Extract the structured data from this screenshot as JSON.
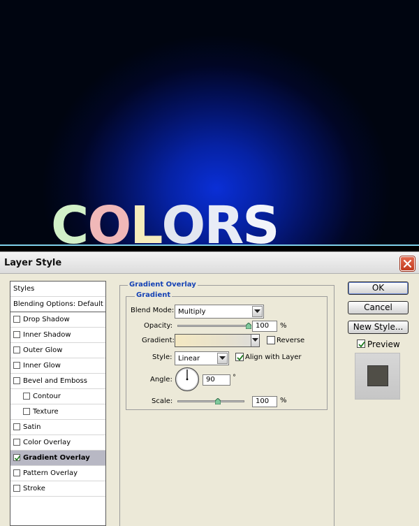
{
  "canvas": {
    "letters": [
      {
        "char": "C",
        "color": "#d2f0c8"
      },
      {
        "char": "O",
        "color": "#f0b8b8"
      },
      {
        "char": "L",
        "color": "#f6ecbc"
      },
      {
        "char": "O",
        "color": "#e2e6f0"
      },
      {
        "char": "R",
        "color": "#e8ecf6"
      },
      {
        "char": "S",
        "color": "#f2f4fa"
      }
    ]
  },
  "dialog": {
    "title": "Layer Style",
    "styles_list": {
      "header": "Styles",
      "blending_options": "Blending Options: Default",
      "items": [
        {
          "label": "Drop Shadow",
          "checked": false
        },
        {
          "label": "Inner Shadow",
          "checked": false
        },
        {
          "label": "Outer Glow",
          "checked": false
        },
        {
          "label": "Inner Glow",
          "checked": false
        },
        {
          "label": "Bevel and Emboss",
          "checked": false
        },
        {
          "label": "Contour",
          "checked": false
        },
        {
          "label": "Texture",
          "checked": false
        },
        {
          "label": "Satin",
          "checked": false
        },
        {
          "label": "Color Overlay",
          "checked": false
        },
        {
          "label": "Gradient Overlay",
          "checked": true
        },
        {
          "label": "Pattern Overlay",
          "checked": false
        },
        {
          "label": "Stroke",
          "checked": false
        }
      ]
    },
    "gradient_overlay": {
      "group_title": "Gradient Overlay",
      "sub_title": "Gradient",
      "blend_mode_label": "Blend Mode:",
      "blend_mode_value": "Multiply",
      "opacity_label": "Opacity:",
      "opacity_value": "100",
      "opacity_unit": "%",
      "opacity_fraction": 1.0,
      "gradient_label": "Gradient:",
      "reverse_label": "Reverse",
      "reverse_checked": false,
      "style_label": "Style:",
      "style_value": "Linear",
      "align_label": "Align with Layer",
      "align_checked": true,
      "angle_label": "Angle:",
      "angle_value": "90",
      "angle_unit": "°",
      "scale_label": "Scale:",
      "scale_value": "100",
      "scale_unit": "%",
      "scale_fraction": 0.6
    },
    "buttons": {
      "ok": "OK",
      "cancel": "Cancel",
      "new_style": "New Style...",
      "preview_label": "Preview",
      "preview_checked": true
    }
  }
}
